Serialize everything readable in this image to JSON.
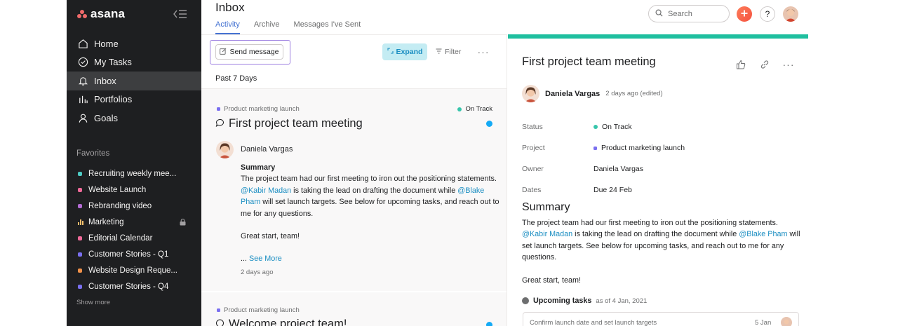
{
  "app": {
    "brand": "asana"
  },
  "sidebar": {
    "nav": [
      {
        "label": "Home",
        "icon": "home-icon"
      },
      {
        "label": "My Tasks",
        "icon": "check-circle-icon"
      },
      {
        "label": "Inbox",
        "icon": "bell-icon",
        "active": true
      },
      {
        "label": "Portfolios",
        "icon": "bar-chart-icon"
      },
      {
        "label": "Goals",
        "icon": "person-icon"
      }
    ],
    "favorites_title": "Favorites",
    "favorites": [
      {
        "label": "Recruiting weekly mee...",
        "color": "#4ecbc4"
      },
      {
        "label": "Website Launch",
        "color": "#f06a99"
      },
      {
        "label": "Rebranding video",
        "color": "#b36bd4"
      },
      {
        "label": "Marketing",
        "color": "#f1bd6c",
        "icon": "bar-chart-icon",
        "locked": true
      },
      {
        "label": "Editorial Calendar",
        "color": "#f06a99"
      },
      {
        "label": "Customer Stories - Q1",
        "color": "#7a6ff0"
      },
      {
        "label": "Website Design Reque...",
        "color": "#f1914a"
      },
      {
        "label": "Customer Stories - Q4",
        "color": "#7a6ff0"
      }
    ],
    "show_more": "Show more"
  },
  "header": {
    "title": "Inbox",
    "tabs": [
      {
        "label": "Activity",
        "active": true
      },
      {
        "label": "Archive"
      },
      {
        "label": "Messages I've Sent"
      }
    ],
    "search_placeholder": "Search",
    "help": "?"
  },
  "list": {
    "send_message": "Send message",
    "expand": "Expand",
    "filter": "Filter",
    "more": "···",
    "period": "Past 7 Days",
    "cards": [
      {
        "project": "Product marketing launch",
        "status": "On Track",
        "title": "First project team meeting",
        "author": "Daniela Vargas",
        "summary_heading": "Summary",
        "body_1": "The project team had our first meeting to iron out the positioning statements. ",
        "mention_1": "@Kabir Madan",
        "body_2": " is taking the lead on drafting the document while ",
        "mention_2": "@Blake Pham",
        "body_3": " will set launch targets. See below for upcoming tasks, and reach out to me for any questions.",
        "closing": "Great start, team!",
        "ellipsis": "... ",
        "see_more": "See More",
        "time": "2 days ago"
      },
      {
        "project": "Product marketing launch",
        "title": "Welcome project team!"
      }
    ]
  },
  "detail": {
    "title": "First project team meeting",
    "author": "Daniela Vargas",
    "ago": "2 days ago (edited)",
    "fields": [
      {
        "label": "Status",
        "value": "On Track",
        "dot": "#37c5ab"
      },
      {
        "label": "Project",
        "value": "Product marketing launch",
        "dot": "#7a6ff0"
      },
      {
        "label": "Owner",
        "value": "Daniela Vargas"
      },
      {
        "label": "Dates",
        "value": "Due 24 Feb"
      }
    ],
    "summary_heading": "Summary",
    "body_1": "The project team had our first meeting to iron out the positioning statements. ",
    "mention_1": "@Kabir Madan",
    "body_2": " is taking the lead on drafting the document while ",
    "mention_2": "@Blake Pham",
    "body_3": " will set launch targets. See below for upcoming tasks, and reach out to me for any questions.",
    "closing": "Great start, team!",
    "upcoming_label": "Upcoming tasks",
    "upcoming_sub": "as of 4 Jan, 2021",
    "task": {
      "name": "Confirm launch date and set launch targets",
      "date": "5 Jan"
    }
  },
  "colors": {
    "accent": "#4573d2",
    "sidebar_bg": "#1e1f21",
    "green_bar": "#1fbf9f",
    "mention": "#1b8ec2",
    "unread": "#14aaf5"
  }
}
